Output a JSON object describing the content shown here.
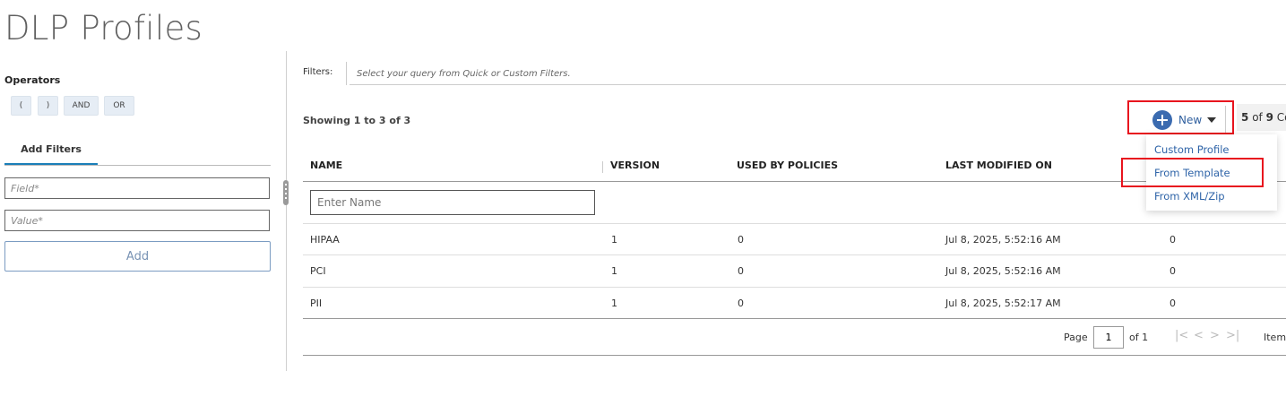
{
  "page": {
    "title": "DLP Profiles"
  },
  "left_panel": {
    "operators_title": "Operators",
    "operators": [
      "(",
      ")",
      "AND",
      "OR"
    ],
    "add_filters_tab": "Add Filters",
    "field_placeholder": "Field*",
    "value_placeholder": "Value*",
    "add_button": "Add"
  },
  "filters": {
    "label": "Filters:",
    "placeholder": "Select your query from Quick or Custom Filters."
  },
  "toolbar": {
    "showing": "Showing 1 to 3 of 3",
    "new_label": "New",
    "columns_current": "5",
    "columns_of": "of",
    "columns_total": "9",
    "columns_suffix": "Co"
  },
  "new_menu": {
    "items": [
      "Custom Profile",
      "From Template",
      "From XML/Zip"
    ],
    "highlighted": "From Template"
  },
  "table": {
    "headers": [
      "NAME",
      "VERSION",
      "USED BY POLICIES",
      "LAST MODIFIED ON"
    ],
    "name_filter_placeholder": "Enter Name",
    "rows": [
      {
        "name": "HIPAA",
        "version": "1",
        "used_by": "0",
        "modified": "Jul 8, 2025, 5:52:16 AM",
        "extra": "0"
      },
      {
        "name": "PCI",
        "version": "1",
        "used_by": "0",
        "modified": "Jul 8, 2025, 5:52:16 AM",
        "extra": "0"
      },
      {
        "name": "PII",
        "version": "1",
        "used_by": "0",
        "modified": "Jul 8, 2025, 5:52:17 AM",
        "extra": "0"
      }
    ]
  },
  "pager": {
    "page_label": "Page",
    "page_value": "1",
    "of_label": "of 1",
    "items_label": "Item"
  },
  "colors": {
    "accent": "#3b6bb0",
    "highlight_box": "#e8141e",
    "tab_underline": "#1a7fb8"
  }
}
